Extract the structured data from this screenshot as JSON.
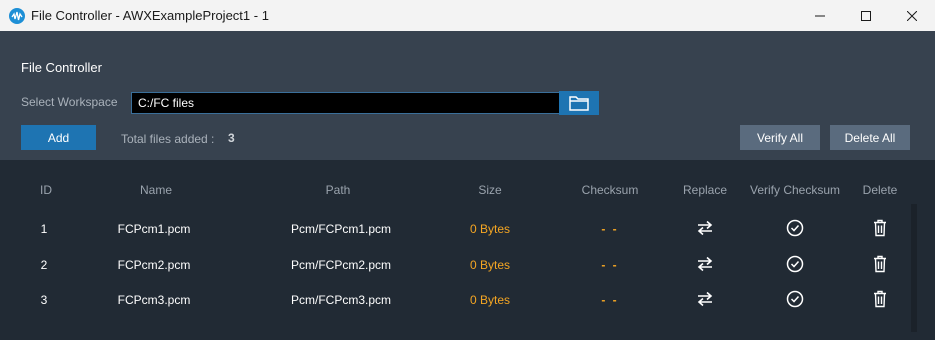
{
  "window": {
    "title": "File Controller - AWXExampleProject1 - 1"
  },
  "panel": {
    "title": "File Controller",
    "workspace_label": "Select Workspace",
    "workspace_value": "C:/FC files",
    "add_label": "Add",
    "total_label": "Total files added :",
    "total_count": "3",
    "verify_all_label": "Verify All",
    "delete_all_label": "Delete All"
  },
  "table": {
    "headers": [
      "ID",
      "Name",
      "Path",
      "Size",
      "Checksum",
      "Replace",
      "Verify Checksum",
      "Delete"
    ],
    "rows": [
      {
        "id": "1",
        "name": "FCPcm1.pcm",
        "path": "Pcm/FCPcm1.pcm",
        "size": "0 Bytes",
        "checksum": "- -"
      },
      {
        "id": "2",
        "name": "FCPcm2.pcm",
        "path": "Pcm/FCPcm2.pcm",
        "size": "0 Bytes",
        "checksum": "- -"
      },
      {
        "id": "3",
        "name": "FCPcm3.pcm",
        "path": "Pcm/FCPcm3.pcm",
        "size": "0 Bytes",
        "checksum": "- -"
      }
    ]
  },
  "colors": {
    "accent": "#1e74b2",
    "size_text": "#f5a623",
    "panel_bg": "#37424f",
    "table_bg": "#212a34"
  },
  "icons": [
    "app-icon",
    "minimize-icon",
    "maximize-icon",
    "close-icon",
    "folder-icon",
    "swap-arrows-icon",
    "check-circle-icon",
    "trash-icon"
  ]
}
